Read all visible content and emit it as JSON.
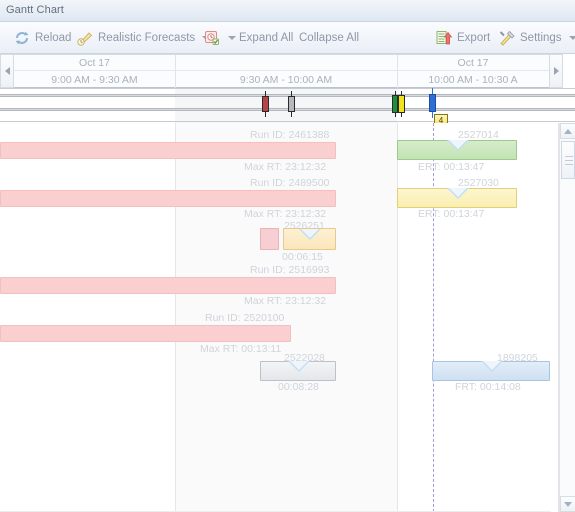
{
  "window": {
    "title": "Gantt Chart"
  },
  "toolbar": {
    "reload_label": "Reload",
    "reload_icon": "refresh-icon",
    "forecasts_label": "Realistic Forecasts",
    "forecasts_icon": "forecast-pencil-icon",
    "filter_icon": "filter-clock-icon",
    "expand_all_label": "Expand All",
    "collapse_all_label": "Collapse All",
    "export_label": "Export",
    "export_icon": "export-upload-icon",
    "settings_label": "Settings",
    "settings_icon": "tools-icon"
  },
  "timeline": {
    "scroll_left_icon": "arrow-left-icon",
    "scroll_right_icon": "arrow-right-icon",
    "days": [
      {
        "label": "Oct 17"
      },
      {
        "label": "Oct 17"
      }
    ],
    "slots": [
      {
        "label": "9:00 AM - 9:30 AM"
      },
      {
        "label": "9:30 AM - 10:00 AM"
      },
      {
        "label": "10:00 AM - 10:30 A"
      }
    ]
  },
  "markers": [
    {
      "name": "marker-red",
      "color": "#b8444a"
    },
    {
      "name": "marker-grey",
      "color": "#b6b9bc"
    },
    {
      "name": "marker-green",
      "color": "#1f8f3a"
    },
    {
      "name": "marker-yellow",
      "color": "#f2e11f"
    },
    {
      "name": "marker-blue",
      "color": "#2d6fd6"
    }
  ],
  "tooltip_badge": {
    "text": "4"
  },
  "rows": [
    {
      "id": "row-1",
      "top_label": "Run ID: 2461388",
      "bottom_label": "Max RT: 23:12:32",
      "bar_type": "pink"
    },
    {
      "id": "row-2",
      "top_label": "Run ID: 2489500",
      "bottom_label": "Max RT: 23:12:32",
      "bar_type": "pink"
    },
    {
      "id": "row-3",
      "top_label": "2526251",
      "bottom_label": "00:06:15",
      "bar_type": "orange"
    },
    {
      "id": "row-4",
      "top_label": "Run ID: 2516993",
      "bottom_label": "Max RT: 23:12:32",
      "bar_type": "pink"
    },
    {
      "id": "row-5",
      "top_label": "Run ID: 2520100",
      "bottom_label": "Max RT: 00:13:11",
      "bar_type": "pink"
    },
    {
      "id": "row-6",
      "top_label": "2522028",
      "bottom_label": "00:08:28",
      "bar_type": "grey"
    },
    {
      "id": "row-7",
      "top_label": "2527014",
      "bottom_label": "ERT: 00:13:47",
      "bar_type": "green"
    },
    {
      "id": "row-8",
      "top_label": "2527030",
      "bottom_label": "ERT: 00:13:47",
      "bar_type": "yellow"
    },
    {
      "id": "row-9",
      "top_label": "1898205",
      "bottom_label": "FRT: 00:14:08",
      "bar_type": "blue"
    }
  ],
  "scrollbar": {
    "up_icon": "scroll-up-icon",
    "down_icon": "scroll-down-icon",
    "thumb": "scroll-thumb"
  },
  "colors": {
    "pink": "#f9cfcf",
    "green": "#c2e3b3",
    "yellow": "#faeeb0",
    "orange": "#fbe6bb",
    "grey": "#e4e7ea",
    "blue": "#cfe0f2",
    "now_line": "#9f9ddb"
  }
}
